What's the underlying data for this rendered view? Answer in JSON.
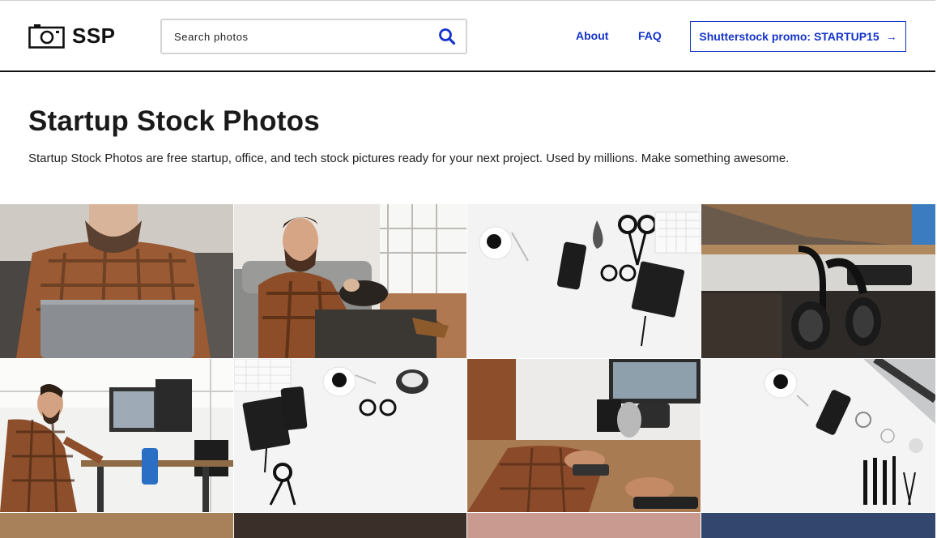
{
  "header": {
    "logo_text": "SSP",
    "search_placeholder": "Search photos",
    "nav": [
      {
        "label": "About"
      },
      {
        "label": "FAQ"
      }
    ],
    "promo": {
      "label": "Shutterstock promo: STARTUP15",
      "arrow": "→"
    }
  },
  "hero": {
    "title": "Startup Stock Photos",
    "subtitle": "Startup Stock Photos are free startup, office, and tech stock pictures ready for your next project. Used by millions. Make something awesome."
  },
  "colors": {
    "accent": "#1534c9",
    "header_border": "#111111"
  },
  "gallery": {
    "photos": [
      {
        "subject": "man in plaid shirt with laptop on sofa"
      },
      {
        "subject": "man on sofa with dog and phone"
      },
      {
        "subject": "flat lay: coffee, phone, glasses, notebook, scissors, keyboard"
      },
      {
        "subject": "headphones hanging under desk"
      },
      {
        "subject": "man at standing desk with monitors"
      },
      {
        "subject": "flat lay: notebook, phone, glasses, coffee, clock, scissors"
      },
      {
        "subject": "man using mouse at desk with microphone"
      },
      {
        "subject": "flat lay: coffee, phone, laptop, makeup brushes"
      }
    ],
    "partial_row_colors": [
      "#a8805a",
      "#3b2f2a",
      "#c99a90",
      "#33466e"
    ]
  }
}
